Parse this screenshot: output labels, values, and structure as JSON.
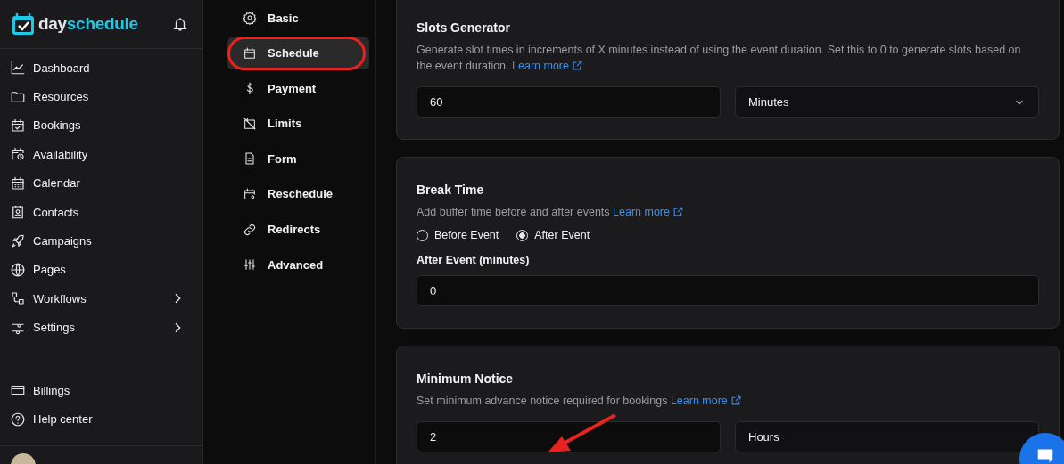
{
  "sidebar": {
    "brand": {
      "first": "day",
      "second": "schedule"
    },
    "nav": [
      {
        "label": "Dashboard",
        "expandable": false
      },
      {
        "label": "Resources",
        "expandable": false
      },
      {
        "label": "Bookings",
        "expandable": false
      },
      {
        "label": "Availability",
        "expandable": false
      },
      {
        "label": "Calendar",
        "expandable": false
      },
      {
        "label": "Contacts",
        "expandable": false
      },
      {
        "label": "Campaigns",
        "expandable": false
      },
      {
        "label": "Pages",
        "expandable": false
      },
      {
        "label": "Workflows",
        "expandable": true
      },
      {
        "label": "Settings",
        "expandable": true
      }
    ],
    "bottom": [
      {
        "label": "Billings"
      },
      {
        "label": "Help center"
      }
    ]
  },
  "subnav": [
    {
      "label": "Basic",
      "selected": false
    },
    {
      "label": "Schedule",
      "selected": true
    },
    {
      "label": "Payment",
      "selected": false
    },
    {
      "label": "Limits",
      "selected": false
    },
    {
      "label": "Form",
      "selected": false
    },
    {
      "label": "Reschedule",
      "selected": false
    },
    {
      "label": "Redirects",
      "selected": false
    },
    {
      "label": "Advanced",
      "selected": false
    }
  ],
  "sections": [
    {
      "title": "Slots Generator",
      "description": "Generate slot times in increments of X minutes instead of using the event duration. Set this to 0 to generate slots based on the event duration.",
      "link": "Learn more",
      "rows": [
        {
          "kind": "pair",
          "value": "60",
          "option": "Minutes",
          "chevron": true
        }
      ]
    },
    {
      "title": "Break Time",
      "description": "Add buffer time before and after events",
      "link": "Learn more",
      "rows": [
        {
          "kind": "radios",
          "options": [
            {
              "label": "Before Event",
              "selected": false
            },
            {
              "label": "After Event",
              "selected": true
            }
          ]
        },
        {
          "kind": "label",
          "text": "After Event (minutes)"
        },
        {
          "kind": "input",
          "value": "0"
        }
      ]
    },
    {
      "title": "Minimum Notice",
      "description": "Set minimum advance notice required for bookings",
      "link": "Learn more",
      "rows": [
        {
          "kind": "pair",
          "value": "2",
          "option": "Hours",
          "chevron": false
        }
      ]
    }
  ]
}
